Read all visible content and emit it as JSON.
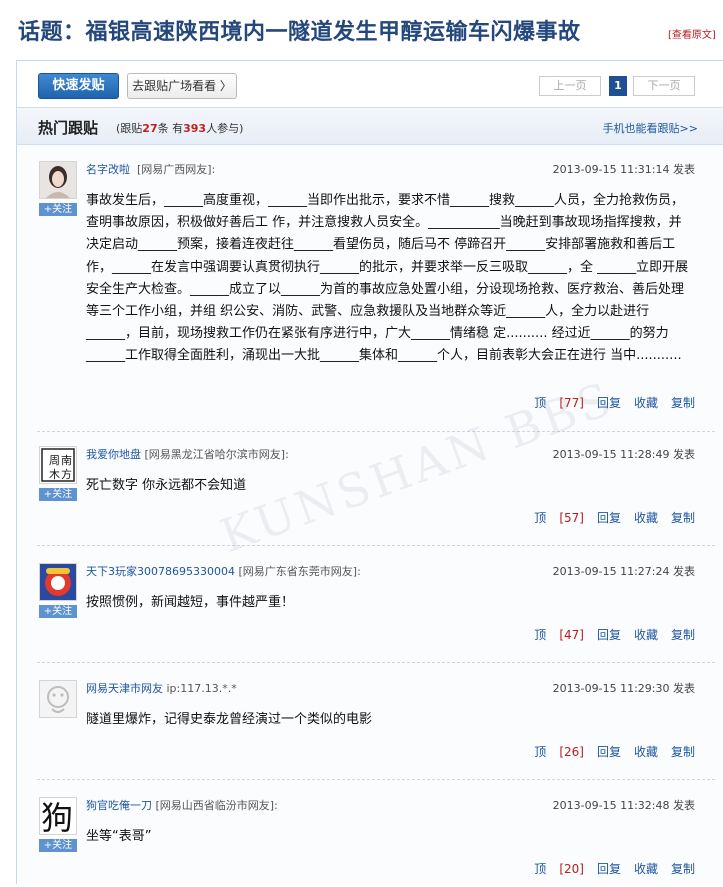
{
  "topic": {
    "title": "话题：福银高速陕西境内一隧道发生甲醇运输车闪爆事故",
    "view_original": "[查看原文]"
  },
  "toolbar": {
    "post_button": "快速发贴",
    "plaza_button": "去跟贴广场看看 〉",
    "pager": {
      "prev": "上一页",
      "current": "1",
      "next": "下一页"
    }
  },
  "hot": {
    "title": "热门跟贴",
    "stats_prefix": "(跟贴",
    "reply_count": "27",
    "stats_mid": "条 有",
    "people_count": "393",
    "stats_suffix": "人参与)",
    "mobile_link": "手机也能看跟贴>>"
  },
  "labels": {
    "follow": "+关注",
    "publish": "发表"
  },
  "actions": {
    "up": "顶",
    "reply": "回复",
    "collect": "收藏",
    "copy": "复制"
  },
  "watermark": "KUNSHAN BBS",
  "posts": [
    {
      "user": "名字改啦",
      "location": "[网易广西网友]:",
      "time": "2013-09-15 11:31:14",
      "up_count": "[77]",
      "body": "事故发生后，______高度重视，______当即作出批示，要求不惜______搜救______人员，全力抢救伤员，查明事故原因，积极做好善后工 作，并注意搜救人员安全。___________当晚赶到事故现场指挥搜救，并决定启动______预案，接着连夜赶往______看望伤员，随后马不 停蹄召开______安排部署施救和善后工作，______在发言中强调要认真贯彻执行______的批示，并要求举一反三吸取______，全 ______立即开展安全生产大检查。______成立了以______为首的事故应急处置小组，分设现场抢救、医疗救治、善后处理等三个工作小组，并组 织公安、消防、武警、应急救援队及当地群众等近______人，全力以赴进行______，目前，现场搜救工作仍在紧张有序进行中，广大______情绪稳 定..........  经过近______的努力______工作取得全面胜利，涌现出一大批______集体和______个人，目前表彰大会正在进行 当中..........."
    },
    {
      "user": "我爱你地盘",
      "location": "[网易黑龙江省哈尔滨市网友]:",
      "time": "2013-09-15 11:28:49",
      "up_count": "[57]",
      "body": "死亡数字 你永远都不会知道"
    },
    {
      "user": "天下3玩家30078695330004",
      "location": "[网易广东省东莞市网友]:",
      "time": "2013-09-15 11:27:24",
      "up_count": "[47]",
      "body": "按照惯例，新闻越短，事件越严重！"
    },
    {
      "user": "网易天津市网友",
      "location": "ip:117.13.*.*",
      "time": "2013-09-15 11:29:30",
      "up_count": "[26]",
      "body": "隧道里爆炸，记得史泰龙曾经演过一个类似的电影"
    },
    {
      "user": "狗官吃俺一刀",
      "location": "[网易山西省临汾市网友]:",
      "time": "2013-09-15 11:32:48",
      "up_count": "[20]",
      "body": "坐等“表哥”"
    }
  ]
}
